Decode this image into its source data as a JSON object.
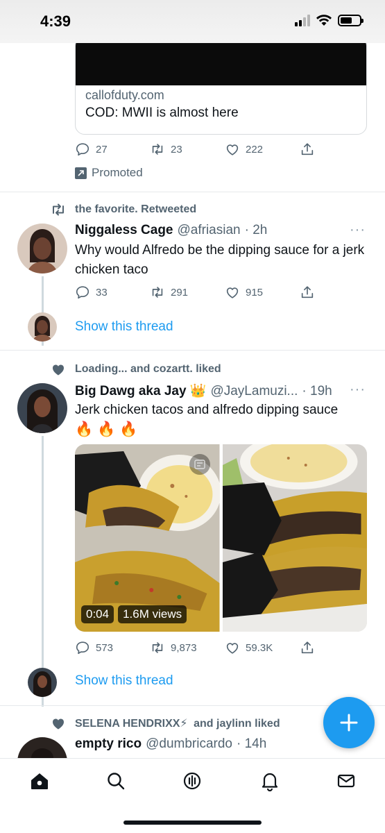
{
  "status_bar": {
    "time": "4:39"
  },
  "promoted_tweet": {
    "card_domain": "callofduty.com",
    "card_title": "COD: MWII is almost here",
    "replies": "27",
    "retweets": "23",
    "likes": "222",
    "promoted_label": "Promoted"
  },
  "tweet1": {
    "context": "the favorite. Retweeted",
    "display_name": "Niggaless Cage",
    "handle": "@afriasian",
    "time": "· 2h",
    "more": "···",
    "text": "Why would Alfredo be the dipping sauce for a jerk chicken taco",
    "replies": "33",
    "retweets": "291",
    "likes": "915",
    "show_thread": "Show this thread"
  },
  "tweet2": {
    "context": "Loading... and cozartt. liked",
    "display_name": "Big Dawg aka Jay 👑",
    "handle": "@JayLamuzi...",
    "time": "· 19h",
    "more": "···",
    "text": "Jerk chicken tacos and alfredo dipping sauce",
    "emojis": "🔥🔥🔥",
    "video_time": "0:04",
    "video_views": "1.6M views",
    "replies": "573",
    "retweets": "9,873",
    "likes": "59.3K",
    "show_thread": "Show this thread"
  },
  "tweet3": {
    "context_name": "SELENA HENDRIXX⚡",
    "context_rest": "and jaylinn liked",
    "display_name": "empty rico",
    "handle": "@dumbricardo",
    "time": "· 14h"
  },
  "colors": {
    "accent": "#1d9bf0",
    "secondary_text": "#536471",
    "primary_text": "#0f1419"
  },
  "icons": [
    "reply-icon",
    "retweet-icon",
    "like-icon",
    "share-icon",
    "home-icon",
    "search-icon",
    "spaces-icon",
    "notifications-icon",
    "messages-icon",
    "compose-icon"
  ]
}
